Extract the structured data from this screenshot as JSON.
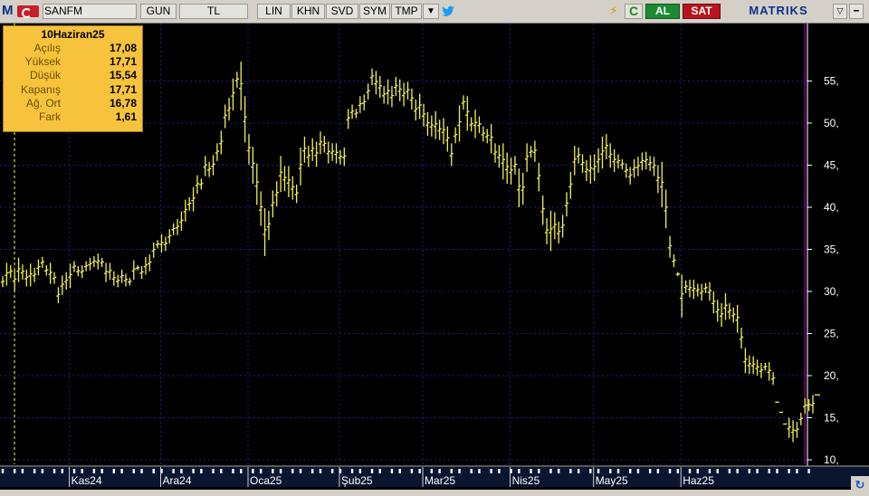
{
  "toolbar": {
    "symbol": "SANFM",
    "buttons": [
      "GUN",
      "TL",
      "LIN",
      "KHN",
      "SVD",
      "SYM",
      "TMP"
    ],
    "buy_label": "AL",
    "sell_label": "SAT",
    "brand": "MATRIKS",
    "logo_letter": "M"
  },
  "info_box": {
    "date": "10Haziran25",
    "rows": [
      {
        "label": "Açılış",
        "value": "17,08"
      },
      {
        "label": "Yüksek",
        "value": "17,71"
      },
      {
        "label": "Düşük",
        "value": "15,54"
      },
      {
        "label": "Kapanış",
        "value": "17,71"
      },
      {
        "label": "Ağ. Ort",
        "value": "16,78"
      },
      {
        "label": "Fark",
        "value": "1,61"
      }
    ]
  },
  "colors": {
    "background": "#000000",
    "bars": "#f0f05a",
    "grid": "#1e1e8c",
    "axis": "#ffffff",
    "crosshair": "#ffff64",
    "info_box": "#f7c33c"
  },
  "chart_data": {
    "type": "bar",
    "subtype": "ohlc",
    "series": [
      {
        "values": [
          [
            30.5,
            31.8
          ],
          [
            30.7,
            33.4
          ],
          [
            31.6,
            33.1
          ],
          [
            30.1,
            32.6
          ],
          [
            31.1,
            34
          ],
          [
            31.4,
            33.2
          ],
          [
            30.6,
            32.6
          ],
          [
            30.6,
            33.3
          ],
          [
            31.1,
            32.8
          ],
          [
            31.9,
            33.8
          ],
          [
            32.8,
            34.1
          ],
          [
            31.9,
            33.1
          ],
          [
            30.9,
            33.4
          ],
          [
            30.9,
            32.3
          ],
          [
            28.6,
            30.5
          ],
          [
            29.6,
            31.9
          ],
          [
            30.2,
            32.3
          ],
          [
            30.4,
            33.3
          ],
          [
            32.3,
            33.6
          ],
          [
            31.8,
            33
          ],
          [
            31.6,
            33.1
          ],
          [
            32.4,
            33.6
          ],
          [
            32.5,
            34
          ],
          [
            32.9,
            34.2
          ],
          [
            32.6,
            34.5
          ],
          [
            32.9,
            34
          ],
          [
            31.1,
            33.4
          ],
          [
            31.4,
            33.4
          ],
          [
            30.7,
            32.4
          ],
          [
            30.5,
            32
          ],
          [
            31,
            32.6
          ],
          [
            30.6,
            32.1
          ],
          [
            30.7,
            31.6
          ],
          [
            31.4,
            33.7
          ],
          [
            32.5,
            33.1
          ],
          [
            31.5,
            33
          ],
          [
            32,
            34.1
          ],
          [
            32.4,
            34.4
          ],
          [
            34,
            35.8
          ],
          [
            35.1,
            36.1
          ],
          [
            34.6,
            36.8
          ],
          [
            34.8,
            36.5
          ],
          [
            35.7,
            37.4
          ],
          [
            36.7,
            38.1
          ],
          [
            36.7,
            38.6
          ],
          [
            37.2,
            39.5
          ],
          [
            38.3,
            40.9
          ],
          [
            39.6,
            41.2
          ],
          [
            39.5,
            42.4
          ],
          [
            41.6,
            43.8
          ],
          [
            42.1,
            43.4
          ],
          [
            43.7,
            46.1
          ],
          [
            43.6,
            45.4
          ],
          [
            43.8,
            46.2
          ],
          [
            45.5,
            47.6
          ],
          [
            46.3,
            49.1
          ],
          [
            49.4,
            52.2
          ],
          [
            50.3,
            53
          ],
          [
            51.5,
            55.3
          ],
          [
            54.2,
            56.1
          ],
          [
            51.5,
            57.3
          ],
          [
            47.7,
            53.2
          ],
          [
            45.1,
            48.7
          ],
          [
            42.8,
            47.2
          ],
          [
            40.3,
            45.2
          ],
          [
            37.8,
            41.9
          ],
          [
            34.2,
            39.9
          ],
          [
            36.1,
            39.6
          ],
          [
            38.8,
            42
          ],
          [
            40.1,
            43.1
          ],
          [
            41.8,
            46.1
          ],
          [
            41.9,
            44.9
          ],
          [
            41.2,
            44.9
          ],
          [
            40.9,
            43.7
          ],
          [
            40.5,
            42.7
          ],
          [
            42.6,
            47.1
          ],
          [
            45.3,
            48.4
          ],
          [
            44.8,
            47.3
          ],
          [
            45.5,
            48.2
          ],
          [
            44.8,
            47.8
          ],
          [
            46.3,
            49
          ],
          [
            46.5,
            48.5
          ],
          [
            45.2,
            47.8
          ],
          [
            45.5,
            47.6
          ],
          [
            45.2,
            47.6
          ],
          [
            45.1,
            46.8
          ],
          [
            44.9,
            47.1
          ],
          [
            49.3,
            51.7
          ],
          [
            50.5,
            52.2
          ],
          [
            50.6,
            51.7
          ],
          [
            51.2,
            53.2
          ],
          [
            51.5,
            53.4
          ],
          [
            52.8,
            54.7
          ],
          [
            54.5,
            56.5
          ],
          [
            53.4,
            56.2
          ],
          [
            53,
            55.6
          ],
          [
            52.3,
            54.4
          ],
          [
            52.2,
            55.2
          ],
          [
            51.9,
            54.4
          ],
          [
            53.2,
            55.5
          ],
          [
            52.6,
            55.2
          ],
          [
            52,
            54.8
          ],
          [
            52.8,
            54.9
          ],
          [
            51.6,
            54.1
          ],
          [
            50.3,
            52.8
          ],
          [
            50.5,
            53.5
          ],
          [
            49.6,
            52.3
          ],
          [
            48.5,
            51.3
          ],
          [
            48.4,
            50.9
          ],
          [
            48.1,
            51.4
          ],
          [
            48,
            50.4
          ],
          [
            47.5,
            50.6
          ],
          [
            46.6,
            49.6
          ],
          [
            44.9,
            47.6
          ],
          [
            47.6,
            49.5
          ],
          [
            47.8,
            52.1
          ],
          [
            51.6,
            53.3
          ],
          [
            49.1,
            53.2
          ],
          [
            49,
            50.7
          ],
          [
            48.2,
            51.6
          ],
          [
            48.8,
            50.8
          ],
          [
            47.8,
            49.6
          ],
          [
            47.6,
            49.3
          ],
          [
            46.4,
            49.9
          ],
          [
            45.3,
            47.6
          ],
          [
            44.7,
            47.4
          ],
          [
            43.3,
            47.6
          ],
          [
            42.8,
            46.5
          ],
          [
            42.7,
            45.9
          ],
          [
            43.9,
            46.1
          ],
          [
            40,
            44.6
          ],
          [
            40.3,
            44.1
          ],
          [
            44.2,
            47.6
          ],
          [
            45.9,
            47.3
          ],
          [
            45.4,
            47.9
          ],
          [
            41.9,
            45.3
          ],
          [
            37.9,
            41.4
          ],
          [
            35.6,
            38.7
          ],
          [
            34.8,
            39.6
          ],
          [
            36.2,
            39.4
          ],
          [
            35.7,
            38.3
          ],
          [
            36.4,
            39.1
          ],
          [
            38.9,
            41.8
          ],
          [
            41,
            44.2
          ],
          [
            43.8,
            47.3
          ],
          [
            45.2,
            47.1
          ],
          [
            44.1,
            46.3
          ],
          [
            43.1,
            45.6
          ],
          [
            42.8,
            46.2
          ],
          [
            43.1,
            46.3
          ],
          [
            44.1,
            47
          ],
          [
            44.6,
            48.4
          ],
          [
            45.7,
            48.7
          ],
          [
            44.7,
            47.6
          ],
          [
            44.2,
            46.9
          ],
          [
            44.6,
            46.3
          ],
          [
            44.5,
            45.7
          ],
          [
            43.5,
            45.2
          ],
          [
            42.7,
            44.8
          ],
          [
            43.5,
            45.7
          ],
          [
            43.7,
            46
          ],
          [
            44.4,
            46.5
          ],
          [
            44.5,
            46.6
          ],
          [
            44.3,
            46.1
          ],
          [
            43.7,
            46
          ],
          [
            41.7,
            45
          ],
          [
            40,
            45.4
          ],
          [
            37.5,
            42.1
          ],
          [
            34,
            36.6
          ],
          [
            32.9,
            34.4
          ],
          [
            31.8,
            32.3
          ],
          [
            26.9,
            32
          ],
          [
            29.8,
            31.3
          ],
          [
            29.3,
            31.4
          ],
          [
            29.1,
            31.4
          ],
          [
            29.4,
            30.9
          ],
          [
            28.9,
            30.9
          ],
          [
            29.8,
            31
          ],
          [
            28.9,
            31.1
          ],
          [
            27.4,
            30
          ],
          [
            26.4,
            29
          ],
          [
            25.8,
            28.6
          ],
          [
            26.6,
            29.8
          ],
          [
            26.7,
            28.6
          ],
          [
            26.3,
            28.1
          ],
          [
            25.1,
            28.4
          ],
          [
            23.2,
            25.7
          ],
          [
            20.3,
            23.3
          ],
          [
            20.2,
            22.4
          ],
          [
            20.2,
            22.3
          ],
          [
            20,
            21.9
          ],
          [
            19.7,
            21.5
          ],
          [
            20.6,
            21.5
          ],
          [
            19.4,
            21.6
          ],
          [
            18.9,
            20.4
          ],
          [
            16.8,
            16.9
          ],
          [
            15.6,
            15.7
          ],
          [
            14.2,
            14.3
          ],
          [
            12.6,
            15
          ],
          [
            12.1,
            14.7
          ],
          [
            12.6,
            14.5
          ],
          [
            14.1,
            15.6
          ],
          [
            15.5,
            17.3
          ],
          [
            15.8,
            17.2
          ],
          [
            15.5,
            17.7
          ]
        ]
      }
    ],
    "y_ticks": [
      "10,",
      "15,",
      "20,",
      "25,",
      "30,",
      "35,",
      "40,",
      "45,",
      "50,",
      "55,"
    ],
    "ylim": [
      9.5,
      60
    ],
    "x_labels": [
      "Kas24",
      "Ara24",
      "Oca25",
      "Şub25",
      "Mar25",
      "Nis25",
      "May25",
      "Haz25"
    ],
    "grid": true,
    "last_value": 17.71
  }
}
